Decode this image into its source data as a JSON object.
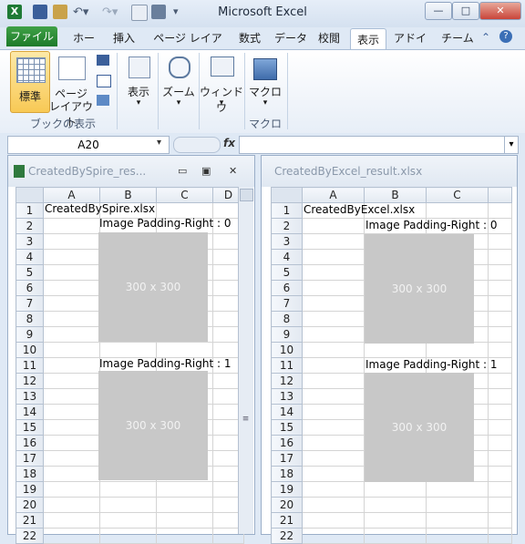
{
  "app": {
    "title": "Microsoft Excel",
    "window_controls": [
      "—",
      "□",
      "✕"
    ]
  },
  "ribbon": {
    "file_tab": "ファイル",
    "tabs": [
      "ホーム",
      "挿入",
      "ページ レイアウト",
      "数式",
      "データ",
      "校閲",
      "表示",
      "アドイン",
      "チーム"
    ],
    "active_tab": "表示",
    "group_book_view": {
      "label": "ブックの表示",
      "standard": "標準",
      "page_layout_line1": "ページ",
      "page_layout_line2": "レイアウト"
    },
    "show": "表示",
    "zoom": "ズーム",
    "window": "ウィンドウ",
    "macro": "マクロ",
    "macro_group": "マクロ"
  },
  "formula_bar": {
    "name_box": "A20",
    "fx": "fx",
    "value": ""
  },
  "left_book": {
    "title": "CreatedBySpire_res...",
    "columns": [
      "A",
      "B",
      "C",
      "D"
    ],
    "rows": [
      "1",
      "2",
      "3",
      "4",
      "5",
      "6",
      "7",
      "8",
      "9",
      "10",
      "11",
      "12",
      "13",
      "14",
      "15",
      "16",
      "17",
      "18",
      "19",
      "20",
      "21",
      "22"
    ],
    "a1": "CreatedBySpire.xlsx",
    "label1": "Image Padding-Right : 0",
    "label2": "Image Padding-Right : 1",
    "image_text": "300 x 300"
  },
  "right_book": {
    "title": "CreatedByExcel_result.xlsx",
    "columns": [
      "A",
      "B",
      "C"
    ],
    "rows": [
      "1",
      "2",
      "3",
      "4",
      "5",
      "6",
      "7",
      "8",
      "9",
      "10",
      "11",
      "12",
      "13",
      "14",
      "15",
      "16",
      "17",
      "18",
      "19",
      "20",
      "21",
      "22"
    ],
    "a1": "CreatedByExcel.xlsx",
    "label1": "Image Padding-Right : 0",
    "label2": "Image Padding-Right : 1",
    "image_text": "300 x 300"
  }
}
